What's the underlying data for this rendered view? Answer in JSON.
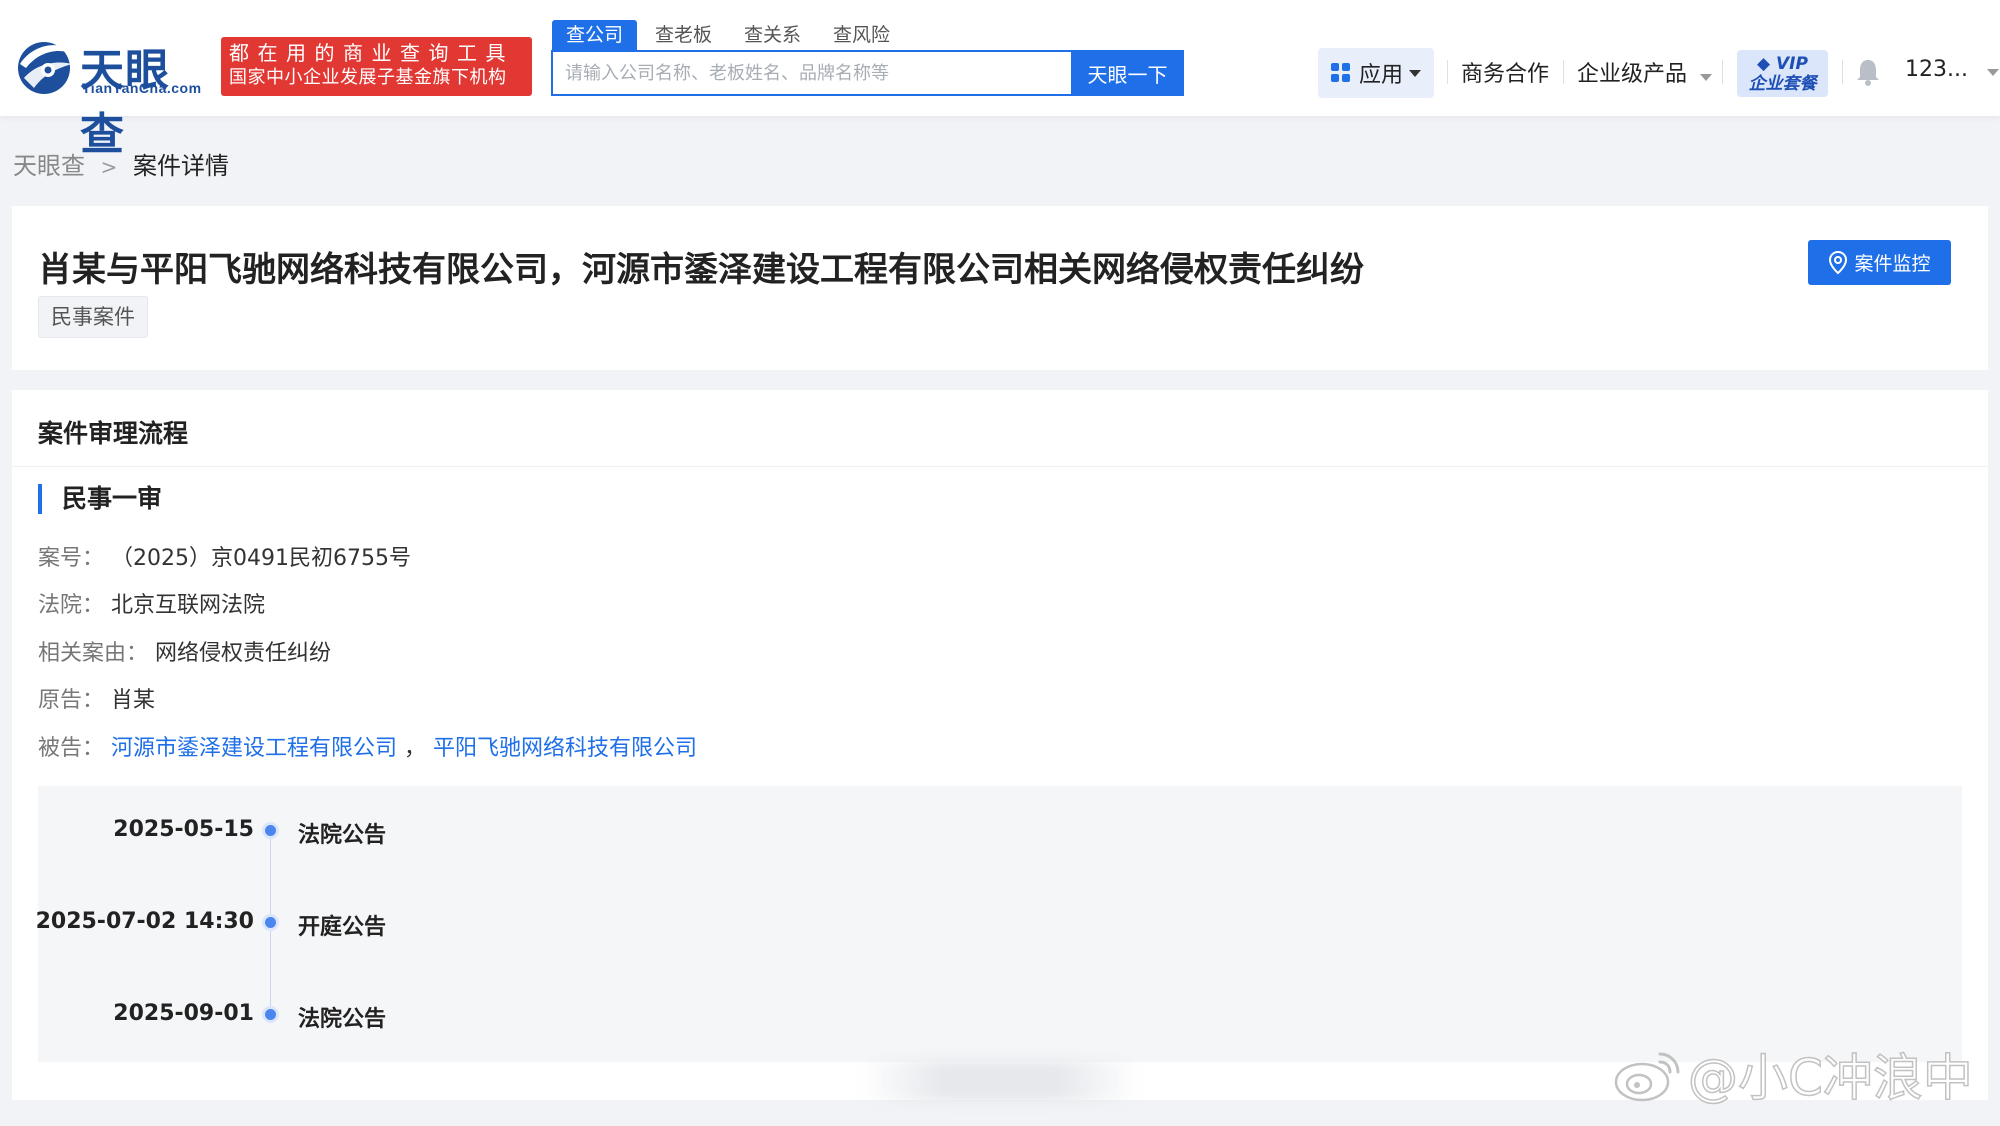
{
  "header": {
    "logo_cn": "天眼查",
    "logo_en": "TianYanCha.com",
    "slogan_line1": "都在用的商业查询工具",
    "slogan_line2": "国家中小企业发展子基金旗下机构",
    "search_tabs": [
      "查公司",
      "查老板",
      "查关系",
      "查风险"
    ],
    "search_placeholder": "请输入公司名称、老板姓名、品牌名称等",
    "search_button": "天眼一下",
    "apps_label": "应用",
    "business_coop": "商务合作",
    "enterprise_products": "企业级产品",
    "vip_top": "VIP",
    "vip_bottom": "企业套餐",
    "user_name": "123..."
  },
  "breadcrumb": {
    "home": "天眼查",
    "separator": ">",
    "current": "案件详情"
  },
  "case": {
    "title": "肖某与平阳飞驰网络科技有限公司，河源市鋈泽建设工程有限公司相关网络侵权责任纠纷",
    "tag": "民事案件",
    "monitor_button": "案件监控"
  },
  "process": {
    "section_title": "案件审理流程",
    "trial_title": "民事一审",
    "fields": {
      "case_no_label": "案号：",
      "case_no": "（2025）京0491民初6755号",
      "court_label": "法院：",
      "court": "北京互联网法院",
      "cause_label": "相关案由：",
      "cause": "网络侵权责任纠纷",
      "plaintiff_label": "原告：",
      "plaintiff": "肖某",
      "defendant_label": "被告：",
      "defendant_1": "河源市鋈泽建设工程有限公司",
      "defendant_sep": "，",
      "defendant_2": "平阳飞驰网络科技有限公司"
    },
    "timeline": [
      {
        "date": "2025-05-15",
        "event": "法院公告"
      },
      {
        "date": "2025-07-02 14:30",
        "event": "开庭公告"
      },
      {
        "date": "2025-09-01",
        "event": "法院公告"
      }
    ]
  },
  "watermark": {
    "text": "@小C冲浪中"
  },
  "colors": {
    "brand_blue": "#1e6fe8",
    "logo_blue": "#1d4f9d",
    "slogan_red": "#e23834",
    "page_bg": "#f1f3f7"
  }
}
